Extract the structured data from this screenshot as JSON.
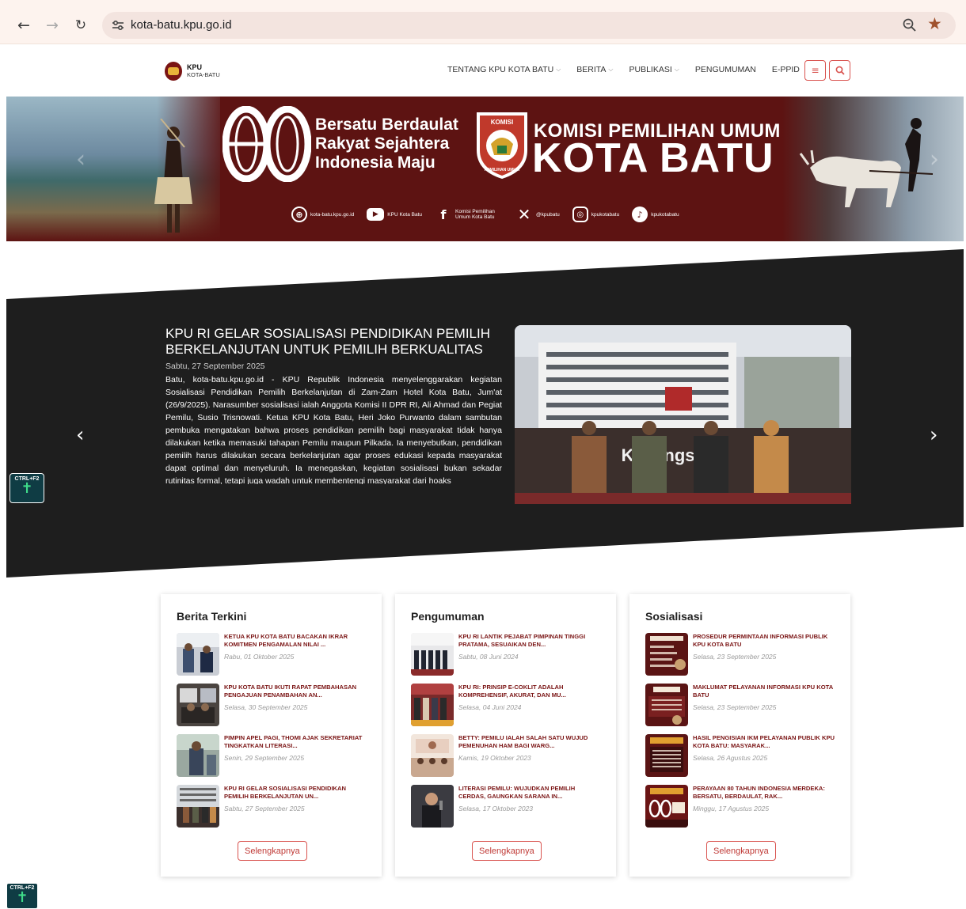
{
  "browser": {
    "url": "kota-batu.kpu.go.id"
  },
  "header": {
    "logo_title": "KPU",
    "logo_sub": "KOTA-BATU",
    "nav": [
      {
        "label": "TENTANG KPU KOTA BATU",
        "caret": "⌵"
      },
      {
        "label": "BERITA",
        "caret": "⌵"
      },
      {
        "label": "PUBLIKASI",
        "caret": "⌵"
      },
      {
        "label": "PENGUMUMAN",
        "caret": ""
      },
      {
        "label": "E-PPID",
        "caret": ""
      }
    ]
  },
  "banner": {
    "number": "80",
    "slogan": [
      "Bersatu Berdaulat",
      "Rakyat Sejahtera",
      "Indonesia Maju"
    ],
    "emblem_text_top": "KOMISI",
    "emblem_text_bottom": "PEMILIHAN UMUM",
    "title_line1": "KOMISI PEMILIHAN UMUM",
    "title_line2": "KOTA BATU",
    "socials": [
      {
        "icon": "globe-icon",
        "label": "kota-batu.kpu.go.id"
      },
      {
        "icon": "youtube-icon",
        "label": "KPU Kota Batu"
      },
      {
        "icon": "facebook-icon",
        "label": "Komisi Pemilihan Umum Kota Batu"
      },
      {
        "icon": "x-icon",
        "label": "@kpubatu"
      },
      {
        "icon": "instagram-icon",
        "label": "kpukotabatu"
      },
      {
        "icon": "tiktok-icon",
        "label": "kpukotabatu"
      }
    ]
  },
  "hero": {
    "title": "KPU RI GELAR SOSIALISASI PENDIDIKAN PEMILIH BERKELANJUTAN UNTUK PEMILIH BERKUALITAS",
    "date": "Sabtu, 27 September 2025",
    "text": "Batu, kota-batu.kpu.go.id -  KPU Republik Indonesia menyelenggarakan kegiatan Sosialisasi Pendidikan Pemilih Berkelanjutan di Zam-Zam Hotel Kota Batu, Jum'at (26/9/2025). Narasumber sosialisasi ialah Anggota Komisi II DPR RI, Ali Ahmad dan Pegiat Pemilu, Susio Trisnowati. Ketua KPU Kota Batu, Heri Joko Purwanto dalam sambutan pembuka mengatakan bahwa proses pendidikan pemilih bagi masyarakat tidak hanya dilakukan ketika memasuki tahapan Pemilu maupun Pilkada. Ia menyebutkan, pendidikan pemilih harus dilakukan secara berkelanjutan agar proses edukasi kepada masyarakat dapat optimal dan menyeluruh. Ia menegaskan, kegiatan sosialisasi bukan sekadar rutinitas formal, tetapi juga wadah untuk membentengi masyarakat dari hoaks",
    "photo_backdrop_text": "Kebangsaan"
  },
  "accessibility": {
    "label": "CTRL+F2"
  },
  "sections": [
    {
      "title": "Berita Terkini",
      "button": "Selengkapnya",
      "posts": [
        {
          "title": "KETUA KPU KOTA BATU BACAKAN IKRAR KOMITMEN PENGAMALAN NILAI ...",
          "date": "Rabu, 01 Oktober 2025"
        },
        {
          "title": "KPU KOTA BATU IKUTI RAPAT PEMBAHASAN PENGAJUAN PENAMBAHAN AN...",
          "date": "Selasa, 30 September 2025"
        },
        {
          "title": "PIMPIN APEL PAGI, THOMI AJAK SEKRETARIAT TINGKATKAN LITERASI...",
          "date": "Senin, 29 September 2025"
        },
        {
          "title": "KPU RI GELAR SOSIALISASI PENDIDIKAN PEMILIH BERKELANJUTAN UN...",
          "date": "Sabtu, 27 September 2025"
        }
      ]
    },
    {
      "title": "Pengumuman",
      "button": "Selengkapnya",
      "posts": [
        {
          "title": "KPU RI LANTIK PEJABAT PIMPINAN TINGGI PRATAMA, SESUAIKAN DEN...",
          "date": "Sabtu, 08 Juni 2024"
        },
        {
          "title": "KPU RI: PRINSIP E-COKLIT ADALAH KOMPREHENSIF, AKURAT, DAN MU...",
          "date": "Selasa, 04 Juni 2024"
        },
        {
          "title": "BETTY: PEMILU IALAH SALAH SATU WUJUD PEMENUHAN HAM BAGI WARG...",
          "date": "Kamis, 19 Oktober 2023"
        },
        {
          "title": "LITERASI PEMILU: WUJUDKAN PEMILIH CERDAS, GAUNGKAN SARANA IN...",
          "date": "Selasa, 17 Oktober 2023"
        }
      ]
    },
    {
      "title": "Sosialisasi",
      "button": "Selengkapnya",
      "posts": [
        {
          "title": "PROSEDUR PERMINTAAN INFORMASI PUBLIK KPU KOTA BATU",
          "date": "Selasa, 23 September 2025"
        },
        {
          "title": "MAKLUMAT PELAYANAN INFORMASI KPU KOTA BATU",
          "date": "Selasa, 23 September 2025"
        },
        {
          "title": "HASIL PENGISIAN IKM PELAYANAN PUBLIK KPU KOTA BATU: MASYARAK...",
          "date": "Selasa, 26 Agustus 2025"
        },
        {
          "title": "PERAYAAN 80 TAHUN INDONESIA MERDEKA: BERSATU, BERDAULAT, RAK...",
          "date": "Minggu, 17 Agustus 2025"
        }
      ]
    }
  ],
  "colors": {
    "brand": "#7a1414",
    "accent_red": "#d9534f",
    "banner_bg": "#5d1312",
    "hero_bg": "#1e1e1e"
  }
}
